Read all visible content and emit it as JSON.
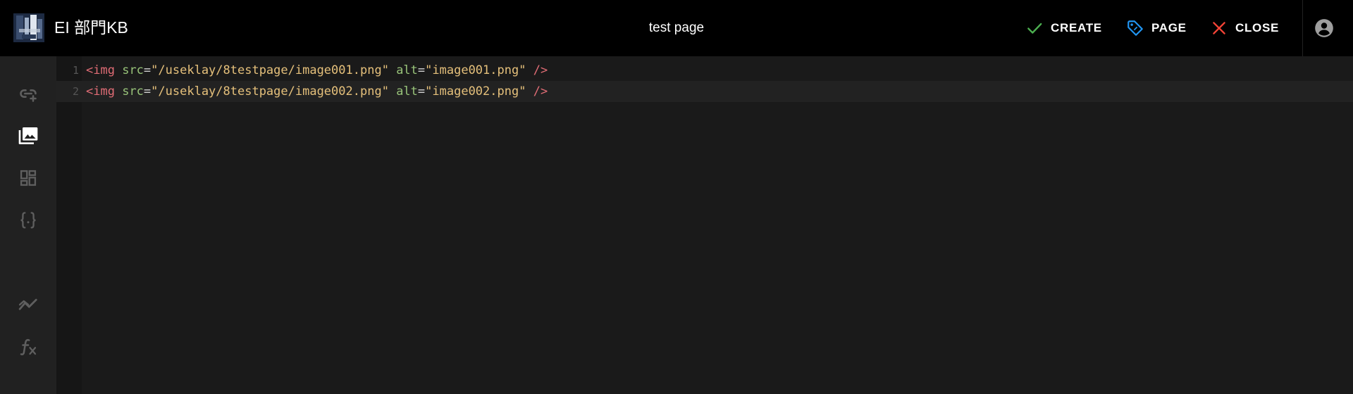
{
  "header": {
    "site_title": "EI 部門KB",
    "page_title": "test page",
    "actions": {
      "create_label": "CREATE",
      "page_label": "PAGE",
      "close_label": "CLOSE"
    },
    "icons": {
      "create": "check-icon",
      "page": "tag-icon",
      "close": "close-icon",
      "account": "account-circle-icon"
    }
  },
  "sidebar": {
    "items": [
      {
        "name": "insert-link",
        "icon": "link-plus-icon"
      },
      {
        "name": "insert-image",
        "icon": "image-multiple-icon",
        "active": true
      },
      {
        "name": "insert-component",
        "icon": "view-dashboard-icon"
      },
      {
        "name": "insert-code-block",
        "icon": "code-braces-icon"
      },
      {
        "name": "insert-chart",
        "icon": "chart-line-icon"
      },
      {
        "name": "insert-formula",
        "icon": "function-variant-icon"
      }
    ]
  },
  "editor": {
    "lines": [
      {
        "number": "1",
        "open": "<img",
        "attr1": "src",
        "eq1": "=",
        "val1": "\"/useklay/8testpage/image001.png\"",
        "attr2": "alt",
        "eq2": "=",
        "val2": "\"image001.png\"",
        "close": "/>"
      },
      {
        "number": "2",
        "open": "<img",
        "attr1": "src",
        "eq1": "=",
        "val1": "\"/useklay/8testpage/image002.png\"",
        "attr2": "alt",
        "eq2": "=",
        "val2": "\"image002.png\"",
        "close": "/>"
      }
    ]
  },
  "colors": {
    "topbar_bg": "#000000",
    "rail_bg": "#212121",
    "editor_bg": "#1a1a1a",
    "create_icon": "#4caf50",
    "page_icon": "#2196f3",
    "close_icon": "#f44336",
    "syntax_tag": "#e06c75",
    "syntax_attr": "#98c379",
    "syntax_string": "#e5c07b"
  }
}
